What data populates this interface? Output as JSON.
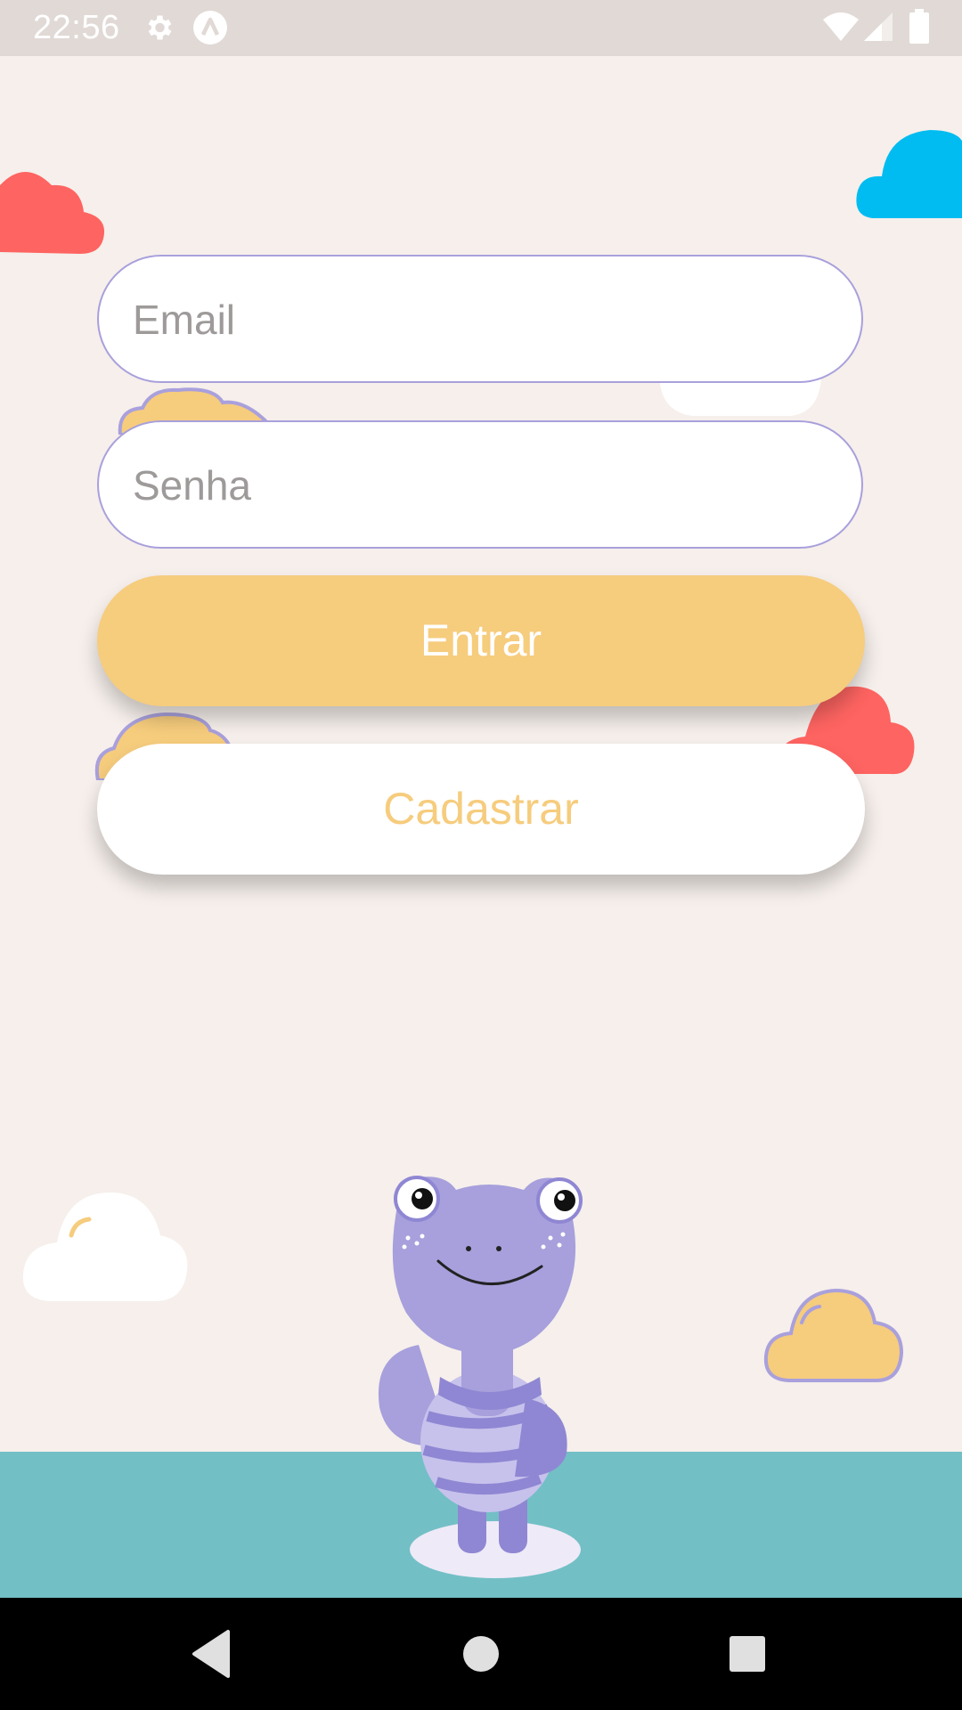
{
  "status_bar": {
    "time": "22:56",
    "left_icons": [
      "gear-icon",
      "app-a-icon"
    ],
    "right_icons": [
      "wifi-icon",
      "signal-icon",
      "battery-icon"
    ]
  },
  "login_form": {
    "email_placeholder": "Email",
    "password_placeholder": "Senha",
    "login_label": "Entrar",
    "register_label": "Cadastrar"
  },
  "colors": {
    "background": "#f6efeb",
    "accent_yellow": "#f6cc7d",
    "border_purple": "#a9a0dc",
    "cloud_red": "#fe6461",
    "cloud_blue": "#00bcf0",
    "ground_teal": "#73bfc6",
    "mascot_purple": "#a7a0dc"
  },
  "nav_bar": {
    "icons": [
      "back-icon",
      "home-icon",
      "recents-icon"
    ]
  }
}
